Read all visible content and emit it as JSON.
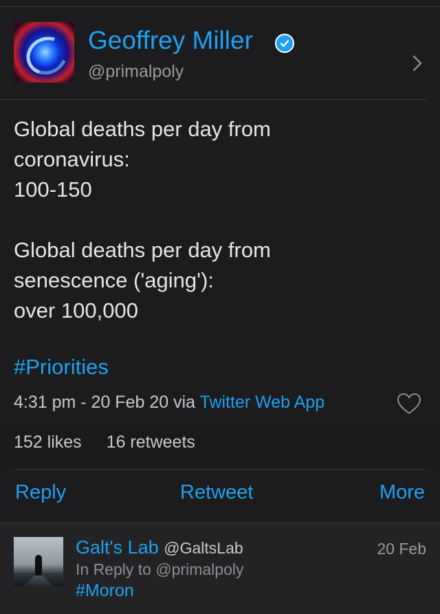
{
  "tweet": {
    "author_name": "Geoffrey Miller",
    "handle": "@primalpoly",
    "verified": true,
    "body_line1": "Global deaths per day from",
    "body_line2": "coronavirus:",
    "body_line3": "100-150",
    "body_line4": "Global deaths per day from",
    "body_line5": "senescence ('aging'):",
    "body_line6": "over 100,000",
    "hashtag": "#Priorities",
    "timestamp": "4:31 pm - 20 Feb 20 via ",
    "source_app": "Twitter Web App",
    "likes": "152 likes",
    "retweets": "16 retweets"
  },
  "actions": {
    "reply": "Reply",
    "retweet": "Retweet",
    "more": "More"
  },
  "reply_tweet": {
    "name": "Galt's Lab",
    "handle": "@GaltsLab",
    "date": "20 Feb",
    "in_reply_to": "In Reply to @primalpoly",
    "text": "#Moron"
  },
  "colors": {
    "accent": "#1da1f2",
    "background": "#1c1c1e",
    "text": "#e6e6e6",
    "secondary_text": "#9a9a9e"
  },
  "icons": {
    "verified": "verified-badge-icon",
    "chevron": "chevron-right-icon",
    "like": "heart-icon"
  }
}
